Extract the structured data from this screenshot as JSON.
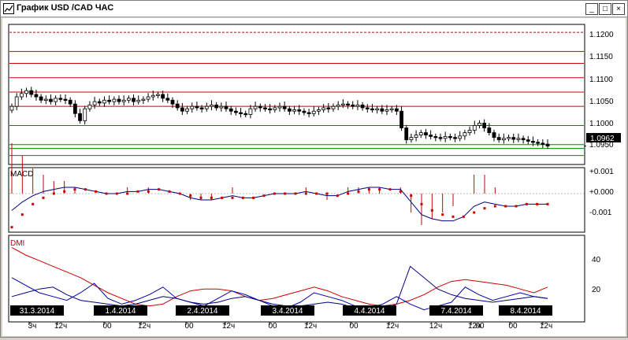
{
  "window": {
    "title": "График USD /CAD  ЧАС",
    "buttons": {
      "minimize": "_",
      "maximize": "□",
      "close": "×"
    }
  },
  "colors": {
    "candles": "#000000",
    "resistance_lines": "#cc0000",
    "support_lines": "#008800",
    "macd_line": "#000080",
    "macd_signal": "#cc0000",
    "dmi_plus": "#0000aa",
    "dmi_minus": "#cc0000",
    "adx": "#000080"
  },
  "price_panel": {
    "axis_labels": [
      "1.1200",
      "1.1150",
      "1.1100",
      "1.1050",
      "1.1000",
      "1.0950"
    ],
    "current_price": "1.0962"
  },
  "macd_panel": {
    "label": "MACD",
    "axis_labels": [
      "+0.001",
      "+0.000",
      "-0.001"
    ]
  },
  "dmi_panel": {
    "label": "DMI",
    "axis_labels": [
      "40",
      "20"
    ]
  },
  "time_axis": {
    "dates": [
      "31.3.2014",
      "1.4.2014",
      "2.4.2014",
      "3.4.2014",
      "4.4.2014",
      "7.4.2014",
      "8.4.2014"
    ],
    "hour_labels": [
      "3ч",
      "12ч",
      "00",
      "12ч",
      "00",
      "12ч",
      "00",
      "12ч",
      "00",
      "12ч",
      "12ч",
      "00",
      "12ч",
      "00",
      "12ч"
    ]
  },
  "chart_data": [
    {
      "type": "candlestick",
      "title": "USD/CAD",
      "ylim": [
        1.0925,
        1.1215
      ],
      "horizontal_levels": {
        "resistance": [
          1.12,
          1.116,
          1.1135,
          1.1105,
          1.1075,
          1.1045
        ],
        "support": [
          1.1005,
          1.0965,
          1.0957,
          1.0942
        ]
      },
      "close": [
        1.1045,
        1.1065,
        1.1072,
        1.1078,
        1.107,
        1.1065,
        1.1058,
        1.106,
        1.1055,
        1.1062,
        1.106,
        1.1058,
        1.105,
        1.103,
        1.1015,
        1.104,
        1.1048,
        1.1055,
        1.1052,
        1.1058,
        1.1055,
        1.106,
        1.1055,
        1.1058,
        1.1062,
        1.1055,
        1.1058,
        1.106,
        1.1065,
        1.1068,
        1.107,
        1.1062,
        1.1058,
        1.105,
        1.1042,
        1.1035,
        1.104,
        1.1045,
        1.1042,
        1.104,
        1.1045,
        1.1048,
        1.1042,
        1.1045,
        1.104,
        1.1035,
        1.1032,
        1.103,
        1.1028,
        1.104,
        1.1045,
        1.1042,
        1.104,
        1.1038,
        1.1042,
        1.1045,
        1.104,
        1.1035,
        1.1038,
        1.1035,
        1.1032,
        1.103,
        1.1035,
        1.1038,
        1.1042,
        1.104,
        1.1045,
        1.1048,
        1.105,
        1.1048,
        1.1045,
        1.1048,
        1.1042,
        1.104,
        1.1038,
        1.104,
        1.1035,
        1.1038,
        1.104,
        1.1035,
        1.1,
        1.0975,
        1.098,
        1.0985,
        1.099,
        1.0985,
        1.0982,
        1.098,
        1.0978,
        1.0982,
        1.098,
        1.0978,
        1.0983,
        1.099,
        1.0995,
        1.1005,
        1.101,
        1.1,
        1.099,
        1.098,
        1.0975,
        1.0978,
        1.098,
        1.0976,
        1.0978,
        1.0975,
        1.0972,
        1.097,
        1.0968,
        1.0966,
        1.0962
      ],
      "last": 1.0962
    },
    {
      "type": "line",
      "title": "MACD",
      "ylim": [
        -0.0018,
        0.0012
      ],
      "series": [
        {
          "values": [
            -0.0008,
            -0.0004,
            -0.0001,
            0.0001,
            0.0002,
            0.0003,
            0.0003,
            0.0002,
            0.0001,
            0.0,
            0.0,
            0.0001,
            0.0001,
            0.0002,
            0.0002,
            0.0001,
            0.0,
            -0.0002,
            -0.0003,
            -0.0003,
            -0.0002,
            -0.0001,
            -0.0002,
            -0.0002,
            -0.0001,
            0.0,
            0.0,
            0.0,
            0.0001,
            0.0,
            -0.0001,
            -0.0001,
            0.0001,
            0.0002,
            0.0003,
            0.0003,
            0.0002,
            0.0002,
            -0.0004,
            -0.001,
            -0.0012,
            -0.0013,
            -0.0013,
            -0.0011,
            -0.0006,
            -0.0004,
            -0.0005,
            -0.0006,
            -0.0006,
            -0.0005,
            -0.0005,
            -0.0005
          ]
        },
        {
          "values": [
            -0.0016,
            -0.001,
            -0.0005,
            -0.0002,
            0.0,
            0.0001,
            0.0002,
            0.0002,
            0.0001,
            0.0,
            0.0,
            0.0,
            0.0001,
            0.0001,
            0.0002,
            0.0001,
            0.0,
            -0.0001,
            -0.0002,
            -0.0002,
            -0.0002,
            -0.0002,
            -0.0002,
            -0.0002,
            -0.0001,
            0.0,
            0.0,
            0.0,
            0.0,
            0.0,
            0.0,
            -0.0001,
            0.0,
            0.0001,
            0.0002,
            0.0002,
            0.0002,
            0.0001,
            -0.0001,
            -0.0005,
            -0.0008,
            -0.001,
            -0.0011,
            -0.0011,
            -0.0009,
            -0.0007,
            -0.0006,
            -0.0006,
            -0.0006,
            -0.0005,
            -0.0005,
            -0.0005
          ]
        }
      ]
    },
    {
      "type": "line",
      "title": "DMI",
      "ylim": [
        5,
        50
      ],
      "series": [
        {
          "values": [
            44,
            40,
            37,
            34,
            31,
            28,
            24,
            20,
            17,
            14,
            13,
            14,
            18,
            21,
            22,
            22,
            21,
            18,
            16,
            17,
            19,
            21,
            23,
            21,
            18,
            16,
            14,
            13,
            14,
            16,
            19,
            23,
            26,
            27,
            26,
            25,
            24,
            22,
            20,
            23
          ]
        },
        {
          "values": [
            28,
            24,
            20,
            18,
            16,
            20,
            25,
            17,
            14,
            16,
            19,
            23,
            17,
            15,
            13,
            17,
            21,
            19,
            16,
            13,
            12,
            15,
            20,
            18,
            16,
            13,
            12,
            14,
            18,
            14,
            11,
            13,
            15,
            23,
            19,
            16,
            18,
            20,
            18,
            17
          ]
        },
        {
          "values": [
            18,
            20,
            22,
            23,
            19,
            16,
            15,
            14,
            13,
            14,
            16,
            18,
            17,
            15,
            14,
            15,
            17,
            18,
            16,
            14,
            13,
            13,
            14,
            15,
            14,
            12,
            11,
            11,
            14,
            34,
            28,
            22,
            19,
            17,
            16,
            15,
            16,
            17,
            18,
            17
          ]
        }
      ]
    }
  ]
}
